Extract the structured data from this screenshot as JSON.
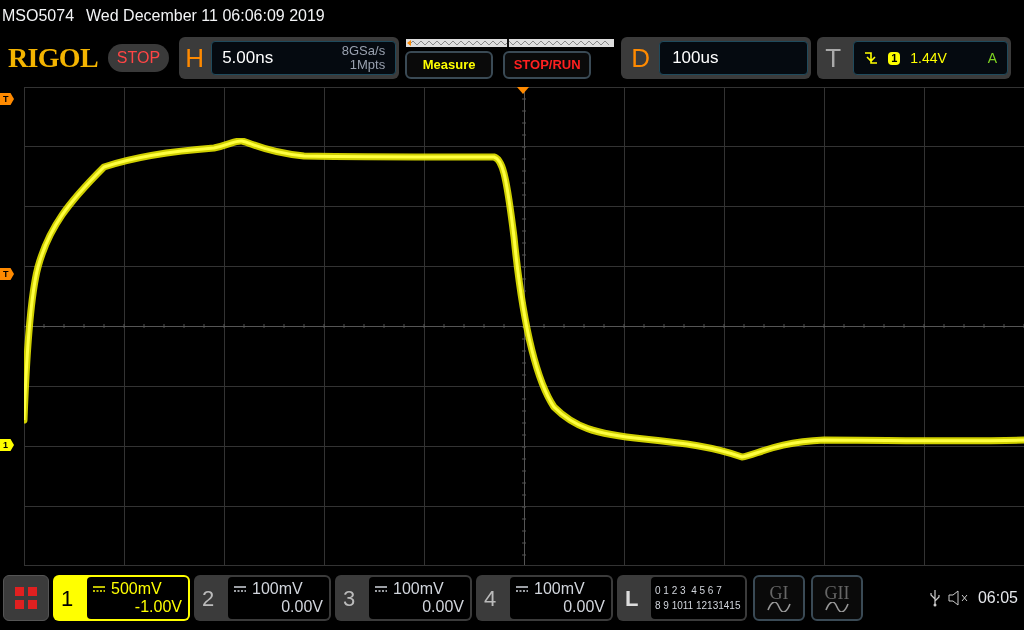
{
  "header": {
    "model": "MSO5074",
    "datetime": "Wed December 11 06:06:09 2019"
  },
  "logo": "RIGOL",
  "run_status": "STOP",
  "horizontal": {
    "label": "H",
    "timebase": "5.00ns",
    "sample_rate": "8GSa/s",
    "memory_depth": "1Mpts"
  },
  "measure_button": "Measure",
  "stop_run_button": "STOP/RUN",
  "delay": {
    "label": "D",
    "value": "100us"
  },
  "trigger": {
    "label": "T",
    "source": "1",
    "level": "1.44V",
    "mode": "A"
  },
  "markers": [
    {
      "kind": "trigger-position",
      "text": "T"
    },
    {
      "kind": "trigger-level",
      "text": "T"
    },
    {
      "kind": "channel-offset",
      "text": "1"
    }
  ],
  "channels": [
    {
      "number": "1",
      "scale": "500mV",
      "offset": "-1.00V",
      "on": true
    },
    {
      "number": "2",
      "scale": "100mV",
      "offset": "0.00V",
      "on": false
    },
    {
      "number": "3",
      "scale": "100mV",
      "offset": "0.00V",
      "on": false
    },
    {
      "number": "4",
      "scale": "100mV",
      "offset": "0.00V",
      "on": false
    }
  ],
  "logic": {
    "label": "L",
    "rows": [
      "0 1 2 3  4 5 6 7",
      "8 9 1011 12131415"
    ]
  },
  "generators": [
    {
      "label": "GI"
    },
    {
      "label": "GII"
    }
  ],
  "status": {
    "time": "06:05"
  }
}
